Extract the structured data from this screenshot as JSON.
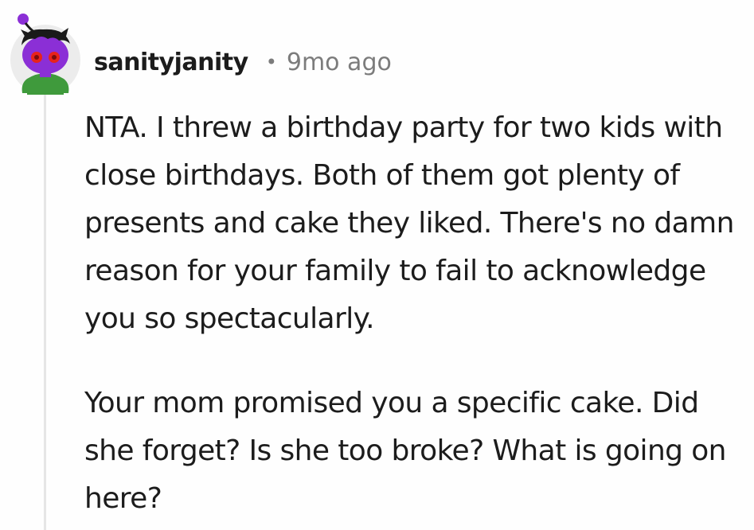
{
  "comment": {
    "username": "sanityjanity",
    "separator": "•",
    "timestamp": "9mo ago",
    "avatar_icon": "snoo-avatar-icon",
    "paragraphs": [
      "NTA. I threw a birthday party for two kids with close birthdays. Both of them got plenty of presents and cake they liked. There's no damn reason for your family to fail to acknowledge you so spectacularly.",
      "Your mom promised you a specific cake. Did she forget? Is she too broke? What is going on here?"
    ]
  },
  "colors": {
    "username": "#1c1c1c",
    "meta": "#7c7c7c",
    "thread_line": "#e6e6e6",
    "avatar_face": "#8b2fd6",
    "avatar_eyes": "#e8231a",
    "avatar_shirt": "#3f9a3c"
  }
}
